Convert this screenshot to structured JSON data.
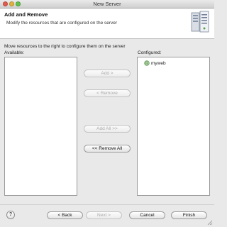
{
  "window": {
    "title": "New Server"
  },
  "banner": {
    "title": "Add and Remove",
    "description": "Modify the resources that are configured on the server"
  },
  "instruction": "Move resources to the right to configure them on the server",
  "available": {
    "label": "Available:",
    "items": []
  },
  "configured": {
    "label": "Configured:",
    "items": [
      "myweb"
    ]
  },
  "buttons": {
    "add": "Add >",
    "remove": "< Remove",
    "add_all": "Add All >>",
    "remove_all": "<< Remove All"
  },
  "footer": {
    "help": "?",
    "back": "< Back",
    "next": "Next >",
    "cancel": "Cancel",
    "finish": "Finish"
  },
  "colors": {
    "window_bg": "#e9e9e9",
    "banner_bg": "#ffffff",
    "disabled_text": "#a9a9a9"
  }
}
